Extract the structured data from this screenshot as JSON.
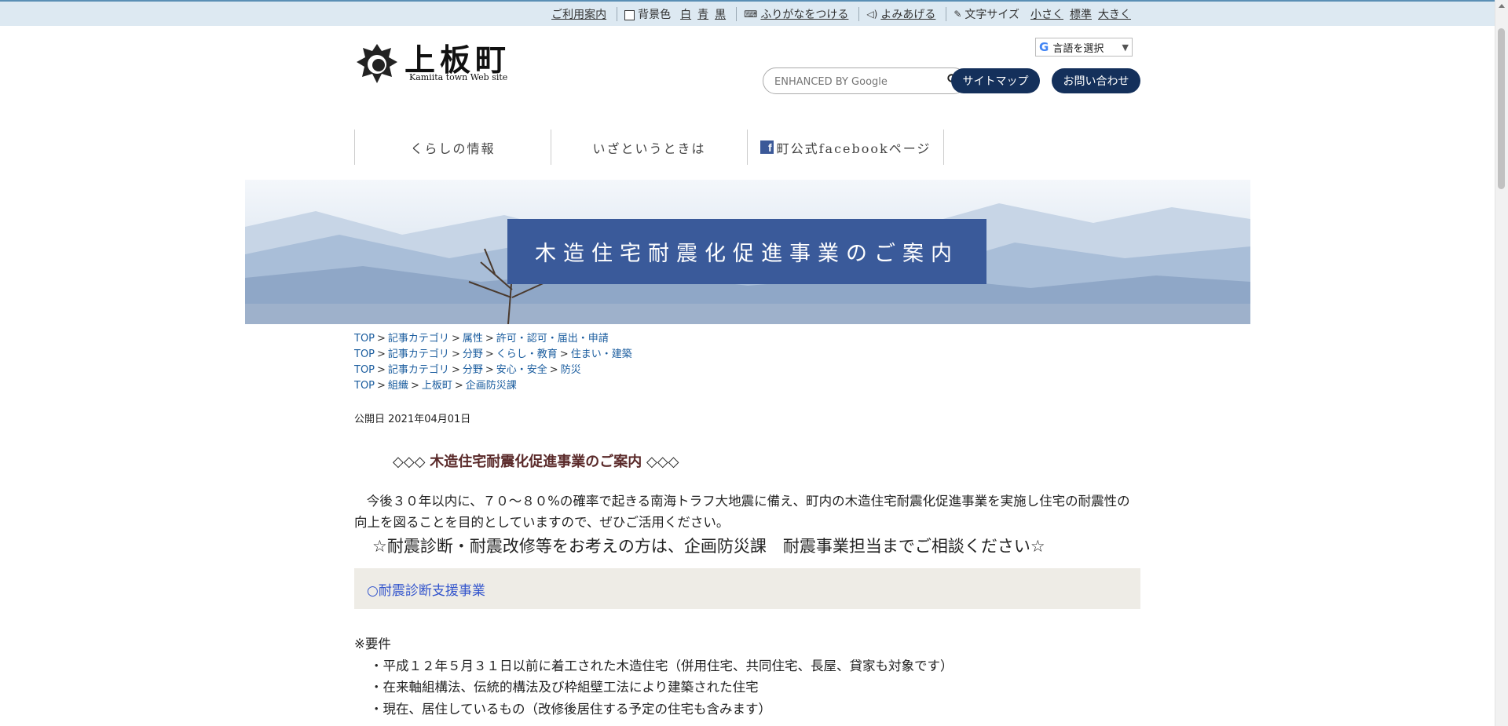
{
  "topbar": {
    "usage_guide": "ご利用案内",
    "bg_color_label": "背景色",
    "bg_white": "白",
    "bg_blue": "青",
    "bg_black": "黒",
    "furigana": "ふりがなをつける",
    "read_aloud": "よみあげる",
    "font_size_label": "文字サイズ",
    "size_small": "小さく",
    "size_standard": "標準",
    "size_large": "大きく"
  },
  "header": {
    "logo_title": "上板町",
    "logo_subtitle": "Kamiita town Web site",
    "language_select": "言語を選択",
    "search_placeholder": "ENHANCED BY Google",
    "sitemap": "サイトマップ",
    "contact": "お問い合わせ"
  },
  "nav": {
    "items": [
      {
        "label": "くらしの情報"
      },
      {
        "label": "いざというときは"
      },
      {
        "label": "町公式facebookページ"
      }
    ]
  },
  "banner": {
    "title": "木造住宅耐震化促進事業のご案内"
  },
  "breadcrumbs": [
    [
      "TOP",
      "記事カテゴリ",
      "属性",
      "許可・認可・届出・申請"
    ],
    [
      "TOP",
      "記事カテゴリ",
      "分野",
      "くらし・教育",
      "住まい・建築"
    ],
    [
      "TOP",
      "記事カテゴリ",
      "分野",
      "安心・安全",
      "防災"
    ],
    [
      "TOP",
      "組織",
      "上板町",
      "企画防災課"
    ]
  ],
  "article": {
    "published": "公開日 2021年04月01日",
    "title_prefix": "◇◇◇",
    "title": "木造住宅耐震化促進事業のご案内",
    "title_suffix": "◇◇◇",
    "intro": "今後３０年以内に、７０～８０%の確率で起きる南海トラフ大地震に備え、町内の木造住宅耐震化促進事業を実施し住宅の耐震性の向上を図ることを目的としていますので、ぜひご活用ください。",
    "call_to_action": "☆耐震診断・耐震改修等をお考えの方は、企画防災課　耐震事業担当までご相談ください☆",
    "section_heading": "○耐震診断支援事業",
    "requirements_heading": "※要件",
    "requirements": [
      "・平成１２年５月３１日以前に着工された木造住宅（併用住宅、共同住宅、長屋、貸家も対象です）",
      "・在来軸組構法、伝統的構法及び枠組壁工法により建築された住宅",
      "・現在、居住しているもの（改修後居住する予定の住宅も含みます）"
    ]
  }
}
